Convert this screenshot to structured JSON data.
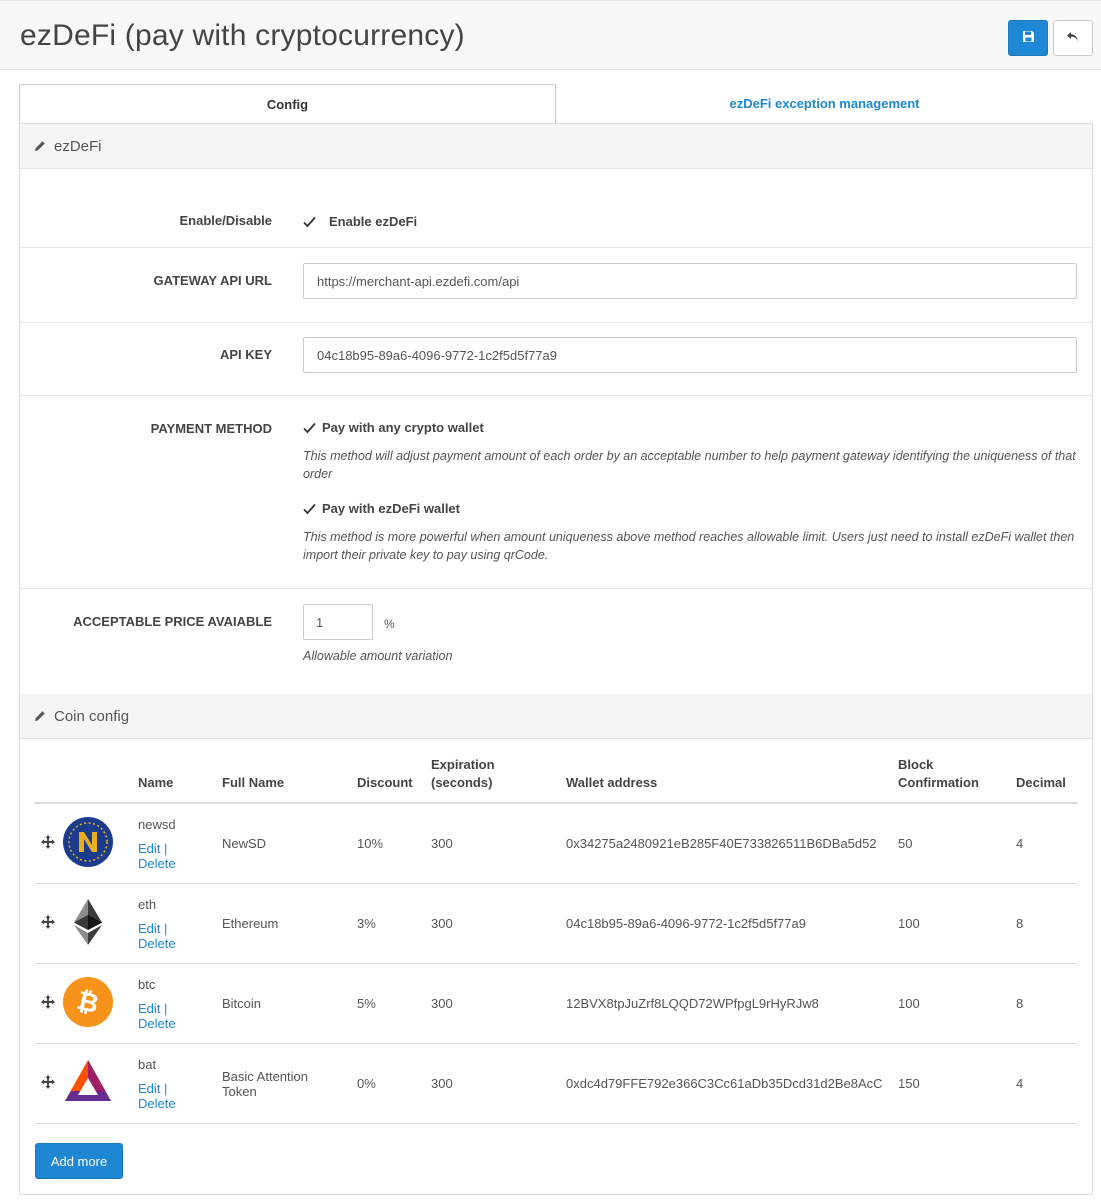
{
  "page": {
    "title": "ezDeFi (pay with cryptocurrency)",
    "save_icon": "save-icon",
    "back_icon": "undo-icon"
  },
  "tabs": [
    {
      "label": "Config",
      "active": true
    },
    {
      "label": "ezDeFi exception management",
      "active": false
    }
  ],
  "sections": {
    "ezdefi": "ezDeFi",
    "coin_config": "Coin config"
  },
  "form": {
    "enable": {
      "label": "Enable/Disable",
      "checkbox_label": "Enable ezDeFi",
      "checked": true
    },
    "gateway": {
      "label": "GATEWAY API URL",
      "value": "https://merchant-api.ezdefi.com/api"
    },
    "api_key": {
      "label": "API KEY",
      "value": "04c18b95-89a6-4096-9772-1c2f5d5f77a9"
    },
    "payment_method": {
      "label": "PAYMENT METHOD",
      "options": [
        {
          "label": "Pay with any crypto wallet",
          "checked": true,
          "help": "This method will adjust payment amount of each order by an acceptable number to help payment gateway identifying the uniqueness of that order"
        },
        {
          "label": "Pay with ezDeFi wallet",
          "checked": true,
          "help": "This method is more powerful when amount uniqueness above method reaches allowable limit. Users just need to install ezDeFi wallet then import their private key to pay using qrCode."
        }
      ]
    },
    "acceptable_price": {
      "label": "ACCEPTABLE PRICE AVAIABLE",
      "value": "1",
      "unit": "%",
      "help": "Allowable amount variation"
    }
  },
  "coin_table": {
    "headers": {
      "name": "Name",
      "full_name": "Full Name",
      "discount": "Discount",
      "expiration_1": "Expiration",
      "expiration_2": "(seconds)",
      "wallet": "Wallet address",
      "block_1": "Block",
      "block_2": "Confirmation",
      "decimal": "Decimal"
    },
    "edit_label": "Edit",
    "separator": "|",
    "delete_label": "Delete",
    "rows": [
      {
        "icon": "newsd-logo-icon",
        "name": "newsd",
        "full_name": "NewSD",
        "discount": "10%",
        "expiration": "300",
        "wallet": "0x34275a2480921eB285F40E733826511B6DBa5d52",
        "block": "50",
        "decimal": "4"
      },
      {
        "icon": "ethereum-logo-icon",
        "name": "eth",
        "full_name": "Ethereum",
        "discount": "3%",
        "expiration": "300",
        "wallet": "04c18b95-89a6-4096-9772-1c2f5d5f77a9",
        "block": "100",
        "decimal": "8"
      },
      {
        "icon": "bitcoin-logo-icon",
        "name": "btc",
        "full_name": "Bitcoin",
        "discount": "5%",
        "expiration": "300",
        "wallet": "12BVX8tpJuZrf8LQQD72WPfpgL9rHyRJw8",
        "block": "100",
        "decimal": "8"
      },
      {
        "icon": "bat-logo-icon",
        "name": "bat",
        "full_name": "Basic Attention Token",
        "discount": "0%",
        "expiration": "300",
        "wallet": "0xdc4d79FFE792e366C3Cc61aDb35Dcd31d2Be8AcC",
        "block": "150",
        "decimal": "4"
      }
    ]
  },
  "add_more_label": "Add more",
  "colors": {
    "primary": "#1e88d4",
    "bitcoin": "#f7931a",
    "newsd_blue": "#1b3c8c",
    "newsd_gold": "#e8b020",
    "bat_red": "#ff5000",
    "bat_purple": "#662d91"
  }
}
